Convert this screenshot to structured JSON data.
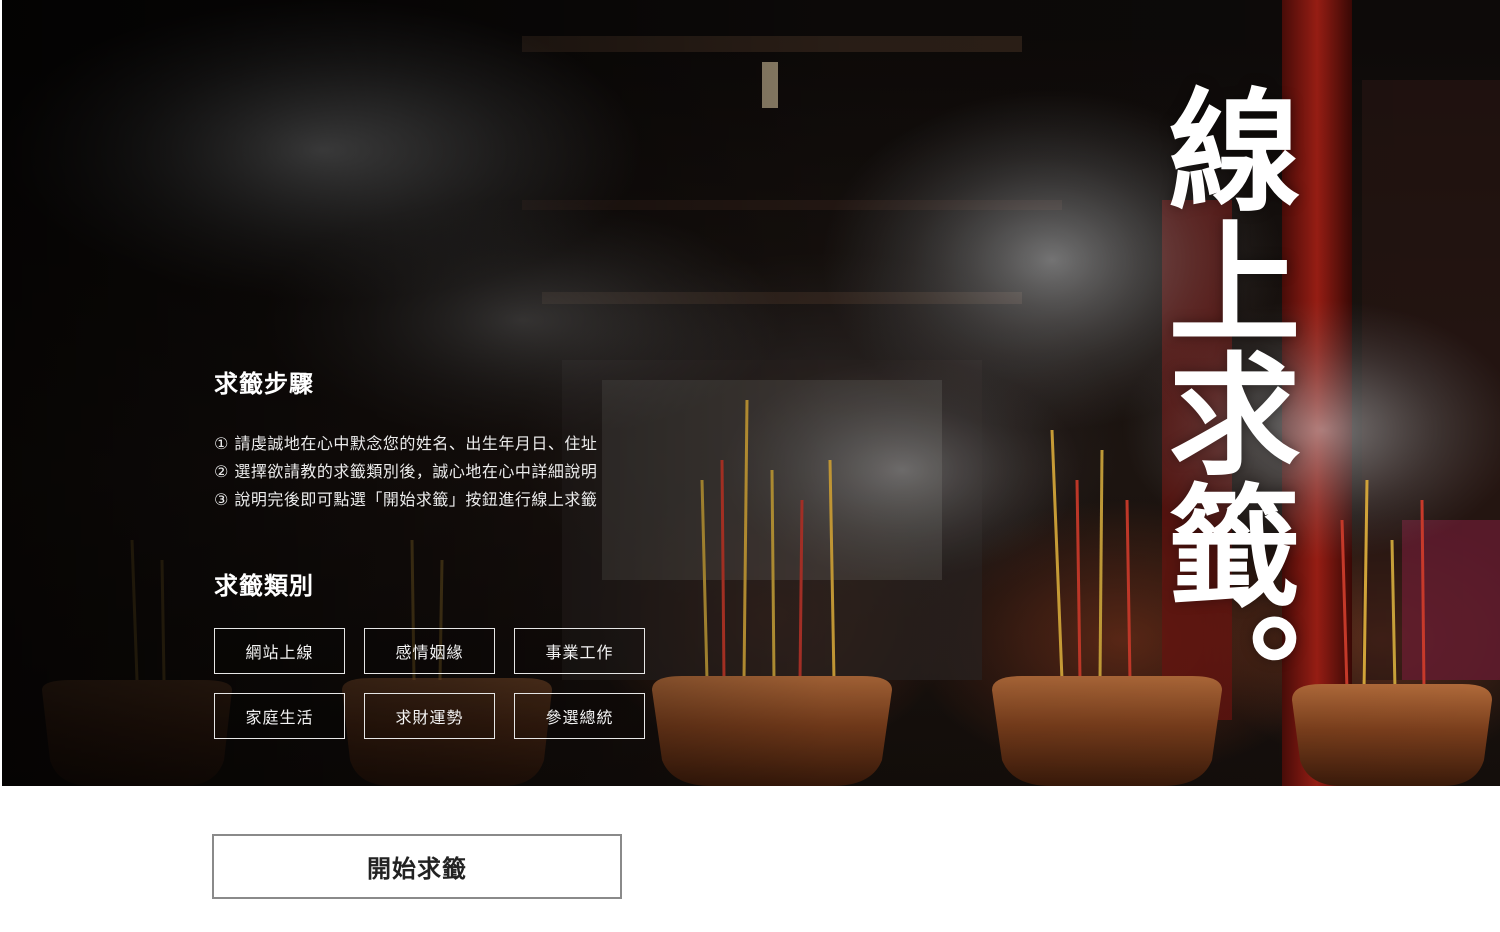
{
  "hero": {
    "title": "線上求籤。",
    "background_image": "temple-incense-photo"
  },
  "steps": {
    "title": "求籤步驟",
    "items": [
      "① 請虔誠地在心中默念您的姓名、出生年月日、住址",
      "② 選擇欲請教的求籤類別後，誠心地在心中詳細說明",
      "③ 說明完後即可點選「開始求籤」按鈕進行線上求籤"
    ]
  },
  "categories": {
    "title": "求籤類別",
    "items": [
      "網站上線",
      "感情姻緣",
      "事業工作",
      "家庭生活",
      "求財運勢",
      "參選總統"
    ]
  },
  "start_button": {
    "label": "開始求籤"
  },
  "colors": {
    "background": "#ffffff",
    "hero_text": "#ffffff",
    "button_border": "#8a8a8a",
    "temple_red": "#8e1a12",
    "incense_gold": "#c9a23a"
  }
}
